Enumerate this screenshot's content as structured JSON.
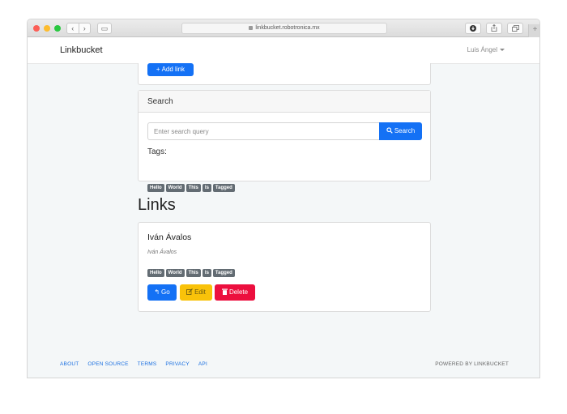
{
  "browser": {
    "url": "linkbucket.robotronica.mx",
    "icons": [
      "back-icon",
      "forward-icon",
      "sidebar-icon",
      "lock-icon",
      "download-icon",
      "share-icon",
      "tabs-icon",
      "new-tab-icon"
    ]
  },
  "navbar": {
    "brand": "Linkbucket",
    "user": "Luis Ángel"
  },
  "add_link": {
    "label": "Add link",
    "icon": "plus-icon"
  },
  "search": {
    "header": "Search",
    "placeholder": "Enter search query",
    "button_label": "Search",
    "button_icon": "search-icon",
    "tags_label": "Tags:",
    "tags": [
      "Hello",
      "World",
      "This",
      "Is",
      "Tagged"
    ]
  },
  "links": {
    "title": "Links",
    "items": [
      {
        "title": "Iván Ávalos",
        "subtitle": "Iván Ávalos",
        "tags": [
          "Hello",
          "World",
          "This",
          "Is",
          "Tagged"
        ],
        "go_label": "Go",
        "edit_label": "Edit",
        "delete_label": "Delete"
      }
    ]
  },
  "footer": {
    "links": [
      "ABOUT",
      "OPEN SOURCE",
      "TERMS",
      "PRIVACY",
      "API"
    ],
    "powered": "POWERED BY LINKBUCKET"
  },
  "colors": {
    "primary": "#1471f5",
    "warning": "#f9c20a",
    "danger": "#ec0f3e",
    "tag": "#636c73"
  }
}
